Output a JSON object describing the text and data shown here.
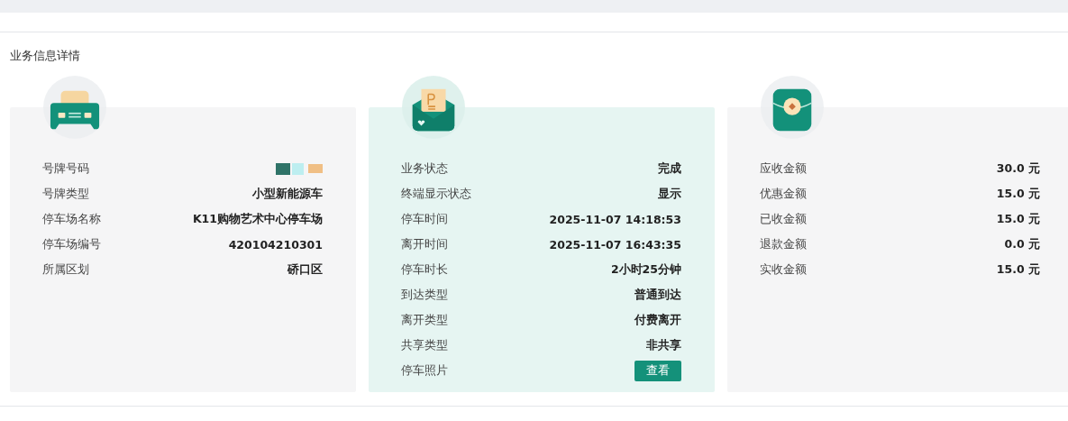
{
  "section_title": "业务信息详情",
  "cards": [
    {
      "highlighted": false,
      "rows": [
        {
          "kind": "redacted",
          "label": "号牌号码"
        },
        {
          "kind": "text",
          "label": "号牌类型",
          "value": "小型新能源车"
        },
        {
          "kind": "text",
          "label": "停车场名称",
          "value": "K11购物艺术中心停车场"
        },
        {
          "kind": "text",
          "label": "停车场编号",
          "value": "420104210301"
        },
        {
          "kind": "text",
          "label": "所属区划",
          "value": "硚口区"
        }
      ]
    },
    {
      "highlighted": true,
      "rows": [
        {
          "kind": "text",
          "label": "业务状态",
          "value": "完成"
        },
        {
          "kind": "text",
          "label": "终端显示状态",
          "value": "显示"
        },
        {
          "kind": "text",
          "label": "停车时间",
          "value": "2025-11-07 14:18:53"
        },
        {
          "kind": "text",
          "label": "离开时间",
          "value": "2025-11-07 16:43:35"
        },
        {
          "kind": "text",
          "label": "停车时长",
          "value": "2小时25分钟"
        },
        {
          "kind": "text",
          "label": "到达类型",
          "value": "普通到达"
        },
        {
          "kind": "text",
          "label": "离开类型",
          "value": "付费离开"
        },
        {
          "kind": "text",
          "label": "共享类型",
          "value": "非共享"
        },
        {
          "kind": "button",
          "label": "停车照片",
          "value": "查看"
        }
      ]
    },
    {
      "highlighted": false,
      "rows": [
        {
          "kind": "text",
          "label": "应收金额",
          "value": "30.0 元"
        },
        {
          "kind": "text",
          "label": "优惠金额",
          "value": "15.0 元"
        },
        {
          "kind": "text",
          "label": "已收金额",
          "value": "15.0 元"
        },
        {
          "kind": "text",
          "label": "退款金额",
          "value": "0.0 元"
        },
        {
          "kind": "text",
          "label": "实收金额",
          "value": "15.0 元"
        }
      ]
    }
  ]
}
